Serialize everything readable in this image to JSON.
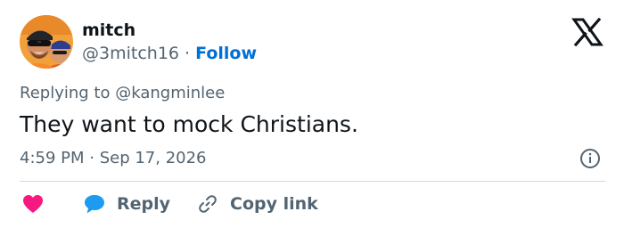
{
  "tweet": {
    "author": {
      "display_name": "mitch",
      "handle": "@3mitch16",
      "separator": "·",
      "follow_label": "Follow",
      "avatar_icon": "avatar-photo"
    },
    "brand_icon": "x-logo-icon",
    "replying_prefix": "Replying to",
    "replying_to": "@kangminlee",
    "text": "They want to mock Christians.",
    "timestamp": "4:59 PM · Sep 17, 2026",
    "info_icon": "info-icon",
    "actions": {
      "like_icon": "heart-icon",
      "reply_label": "Reply",
      "reply_icon": "speech-bubble-icon",
      "copy_label": "Copy link",
      "copy_icon": "link-icon"
    }
  },
  "colors": {
    "text_primary": "#0f1419",
    "text_secondary": "#536471",
    "follow_blue": "#006fd6",
    "heart_pink": "#f91880",
    "reply_blue": "#1d9bf0",
    "divider": "#cfd9de"
  }
}
